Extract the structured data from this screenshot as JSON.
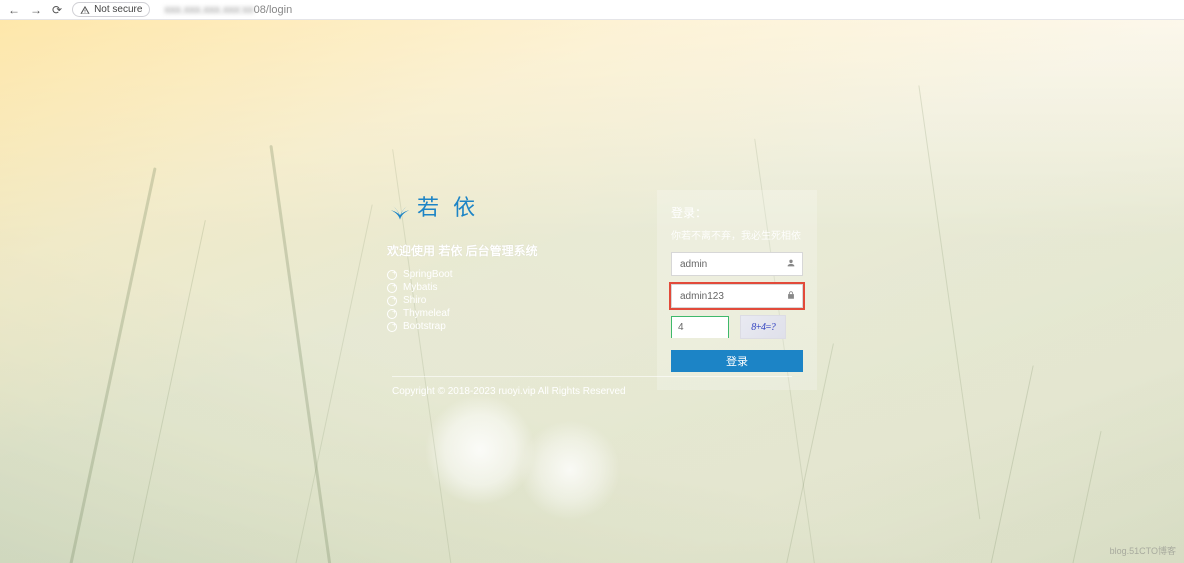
{
  "browser": {
    "security_label": "Not secure",
    "url_hidden": "xxx.xxx.xxx.xxx:xx",
    "url_suffix": "08/login"
  },
  "brand": {
    "name": "若 依"
  },
  "welcome": "欢迎使用 若依 后台管理系统",
  "features": [
    "SpringBoot",
    "Mybatis",
    "Shiro",
    "Thymeleaf",
    "Bootstrap"
  ],
  "login": {
    "title": "登录：",
    "subtitle": "你若不离不弃，我必生死相依",
    "username": "admin",
    "password": "admin123",
    "captcha_input": "4",
    "captcha_text": "8+4=?",
    "button": "登录"
  },
  "copyright": "Copyright © 2018-2023 ruoyi.vip All Rights Reserved",
  "watermark": "blog.51CTO博客"
}
